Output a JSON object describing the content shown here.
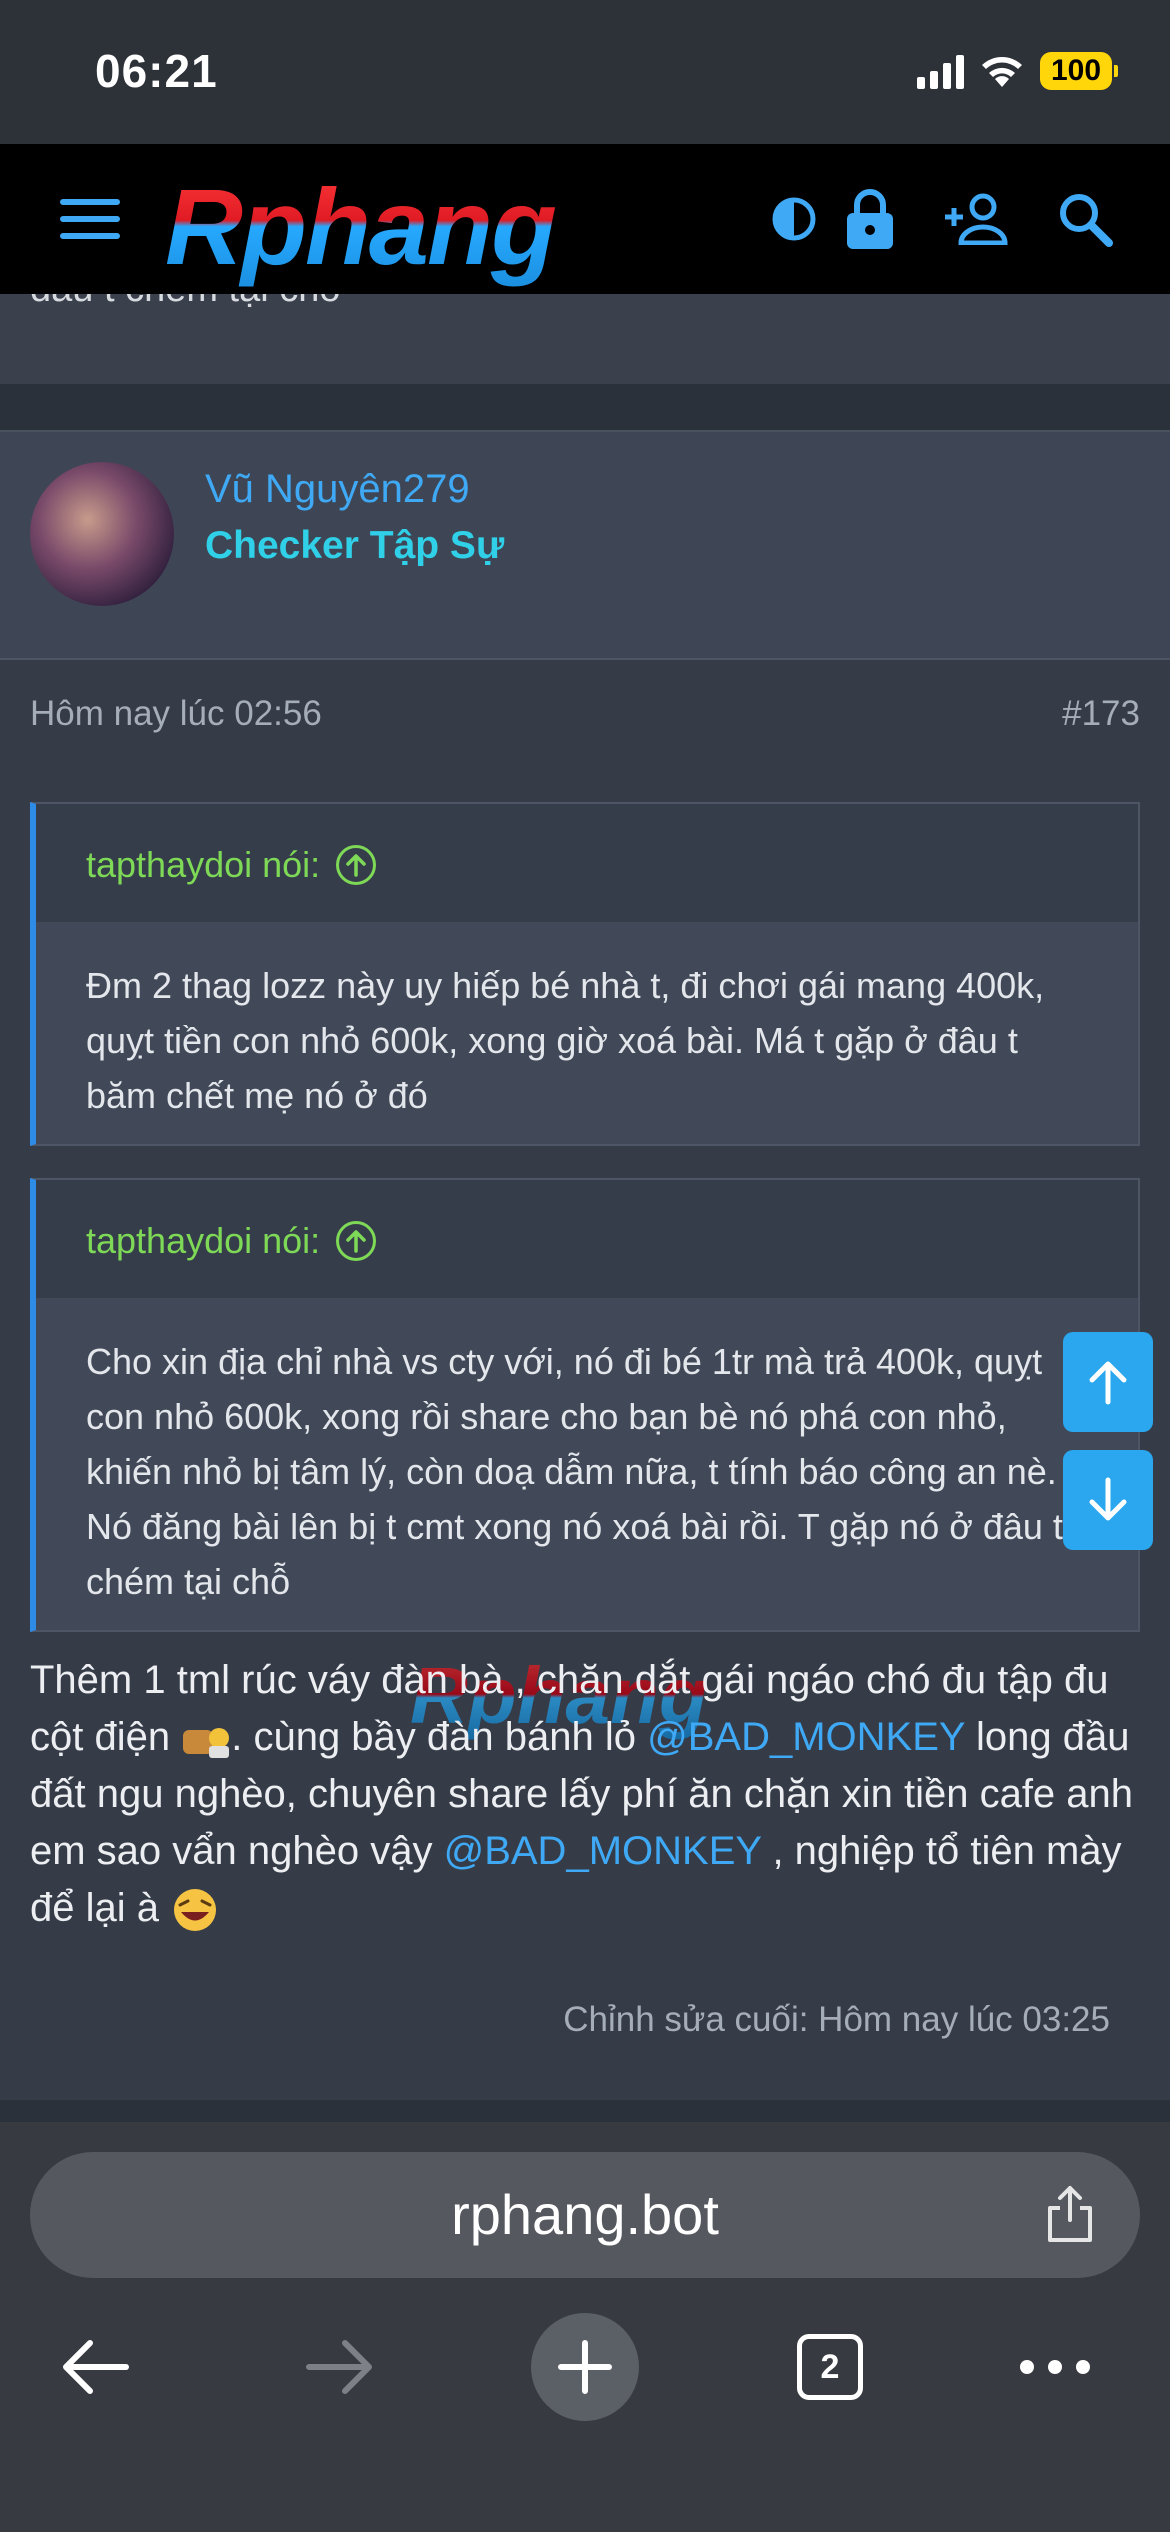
{
  "status_bar": {
    "time": "06:21",
    "battery": "100"
  },
  "header": {
    "logo": "Rphang"
  },
  "prev_post": {
    "text": "đâu t chém tại chỗ"
  },
  "post": {
    "username": "Vũ Nguyên279",
    "user_title": "Checker Tập Sự",
    "timestamp": "Hôm nay lúc 02:56",
    "post_number": "#173",
    "quotes": [
      {
        "author": "tapthaydoi nói:",
        "text": "Đm 2 thag lozz này uy hiếp bé nhà t, đi chơi gái mang 400k, quỵt tiền con nhỏ 600k, xong giờ xoá bài. Má t gặp ở đâu t băm chết mẹ nó ở đó"
      },
      {
        "author": "tapthaydoi nói:",
        "text": "Cho xin địa chỉ nhà vs cty với, nó đi bé 1tr mà trả 400k, quỵt con nhỏ 600k, xong rồi share cho bạn bè nó phá con nhỏ, khiến nhỏ bị tâm lý, còn doạ dẫm nữa, t tính báo công an nè. Nó đăng bài lên bị t cmt xong nó xoá bài rồi. T gặp nó ở đâu t chém tại chỗ"
      }
    ],
    "body": {
      "part1": "Thêm 1 tml rúc váy đàn bà , chăn dắt gái ngáo chó đu tập đu cột điện ",
      "part2": ". cùng bầy đàn bánh lỏ ",
      "mention": "@BAD_MONKEY",
      "part3": " long đầu đất ngu nghèo, chuyên share lấy phí ăn chặn xin tiền cafe anh em sao vẩn nghèo vậy ",
      "mention2": "@BAD_MONKEY",
      "part4": " , nghiệp tổ tiên mày để lại à "
    },
    "edited": "Chỉnh sửa cuối: Hôm nay lúc 03:25",
    "watermark": "Rphang"
  },
  "browser": {
    "url": "rphang.bot",
    "tab_count": "2"
  },
  "colors": {
    "accent": "#3fa9f5",
    "quote_author": "#7ed957",
    "rank": "#2fd0e8"
  }
}
